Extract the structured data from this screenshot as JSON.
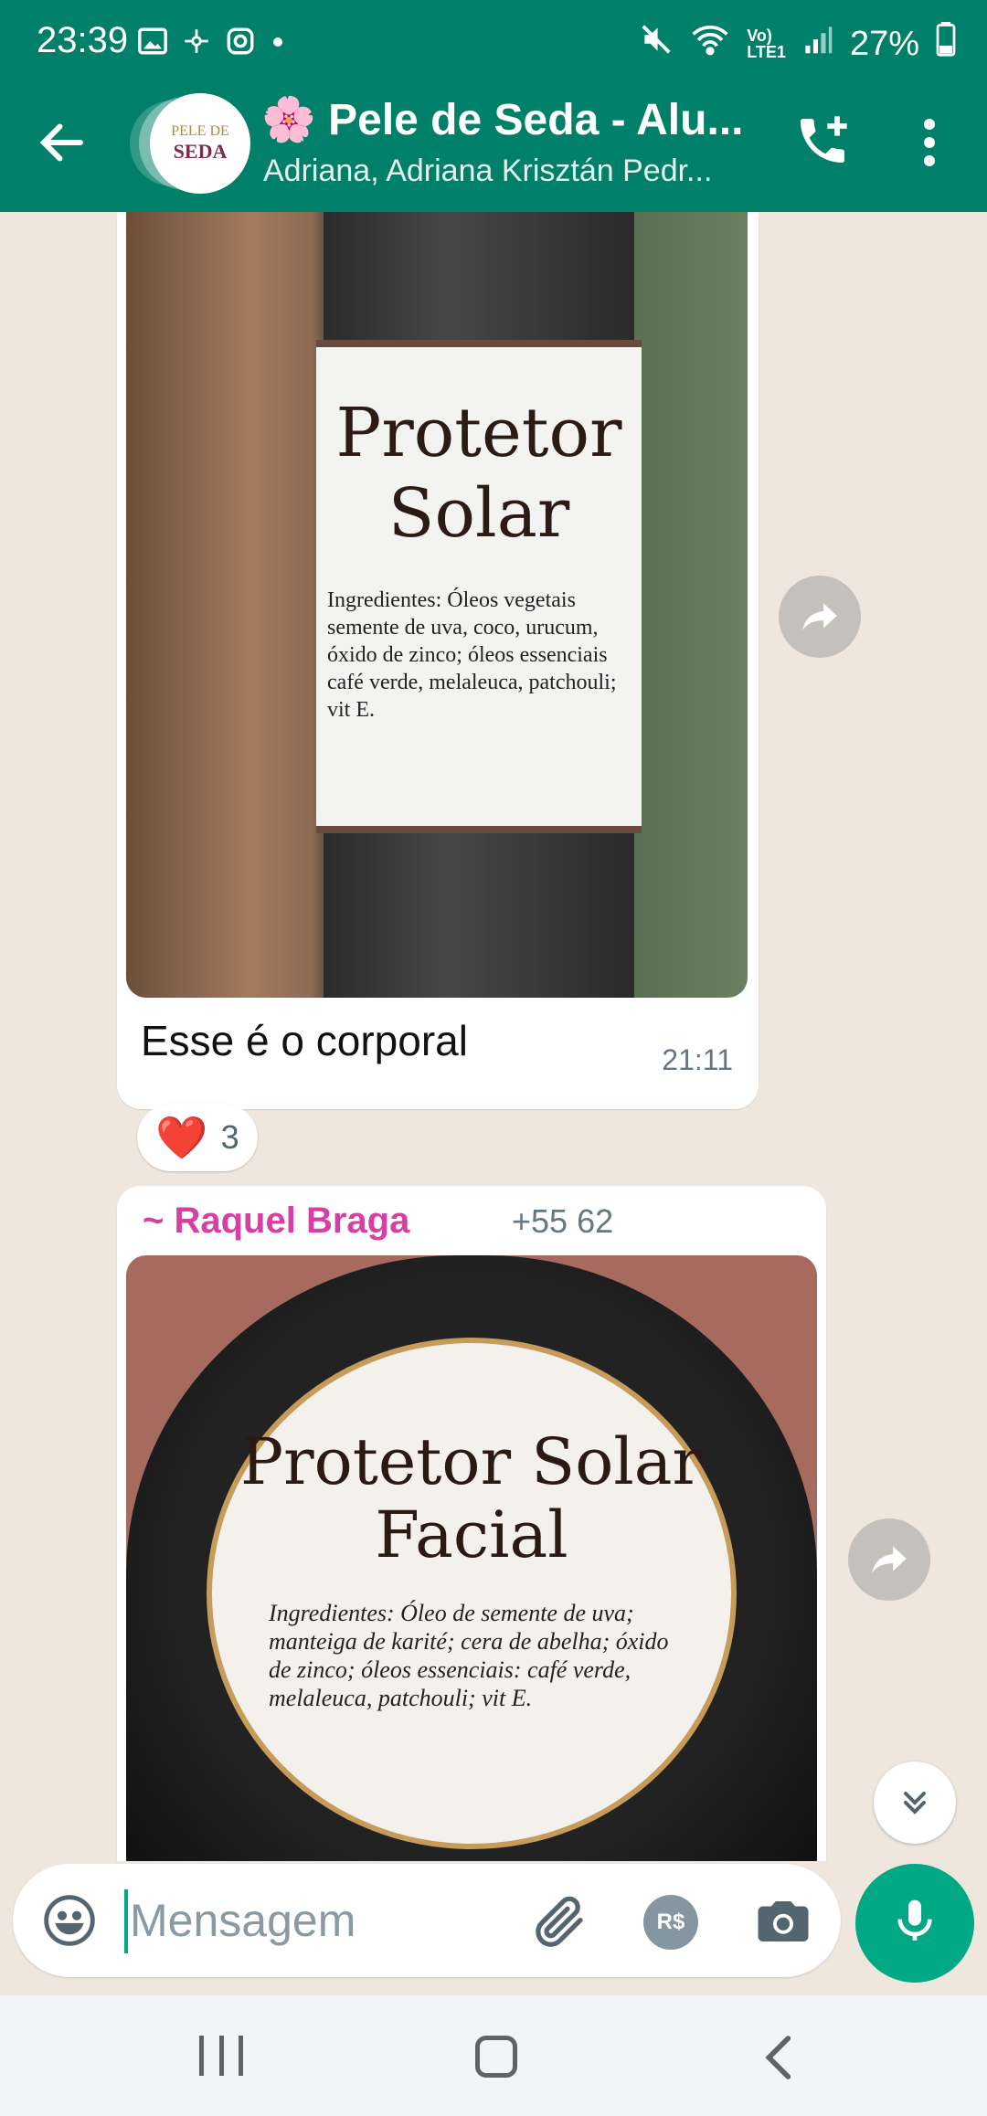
{
  "status_bar": {
    "time": "23:39",
    "battery": "27%",
    "icons": [
      "image-icon",
      "pinwheel-icon",
      "instagram-icon",
      "dot-icon",
      "mute-icon",
      "wifi-icon",
      "volte-icon",
      "signal-icon",
      "battery-icon"
    ]
  },
  "header": {
    "avatar_text_top": "PELE DE",
    "avatar_text_main": "SEDA",
    "title": "🌸 Pele de Seda - Alu...",
    "subtitle": "Adriana, Adriana Krisztán Pedr...",
    "colors": {
      "header": "#008069",
      "accent": "#00a884"
    }
  },
  "messages": [
    {
      "type": "image",
      "image_text_title": "Protetor Solar",
      "image_text_ingredients": "Ingredientes: Óleos vegetais semente de uva, coco, urucum, óxido de zinco; óleos essenciais café verde, melaleuca, patchouli; vit E.",
      "caption": "Esse é o corporal",
      "time": "21:11",
      "reaction": {
        "emoji": "❤️",
        "count": "3"
      }
    },
    {
      "type": "image",
      "sender": "~ Raquel Braga",
      "phone": "+55 62",
      "image_text_title": "Protetor Solar Facial",
      "image_text_ingredients": "Ingredientes: Óleo de semente de uva; manteiga de karité; cera de abelha; óxido de zinco; óleos essenciais: café verde, melaleuca, patchouli; vit E."
    }
  ],
  "composer": {
    "placeholder": "Mensagem",
    "pay_label": "R$"
  }
}
